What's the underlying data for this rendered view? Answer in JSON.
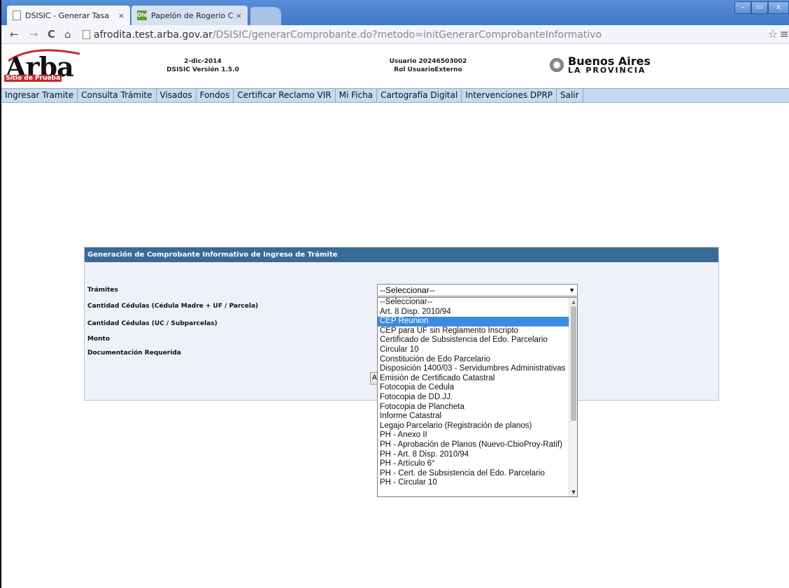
{
  "browser": {
    "tabs": [
      {
        "title": "DSISIC - Generar Tasa",
        "close": "×"
      },
      {
        "title": "Papelón de Rogerio Ceni | Ol",
        "close": "×",
        "favicon": "Olé"
      }
    ],
    "window_controls": {
      "minimize": "–",
      "maximize": "▭",
      "close": "x"
    },
    "nav": {
      "back": "←",
      "forward": "→",
      "reload": "C",
      "home": "⌂",
      "star": "☆",
      "menu": "≡"
    },
    "url": {
      "host": "afrodita.test.arba.gov.ar",
      "path": "/DSISIC/generarComprobante.do?metodo=initGenerarComprobanteInformativo"
    }
  },
  "header": {
    "logo": "Arba",
    "logo_sub": "Sitio de Prueba",
    "date": "2-dic-2014",
    "version": "DSISIC Versión 1.5.0",
    "user": "Usuario 20246503002",
    "role": "Rol UsuarioExterno",
    "province_line1": "Buenos Aires",
    "province_line2": "LA PROVINCIA"
  },
  "menu": [
    "Ingresar Tramite",
    "Consulta Trámite",
    "Visados",
    "Fondos",
    "Certificar Reclamo VIR",
    "Mi Ficha",
    "Cartografía Digital",
    "Intervenciones DPRP",
    "Salir"
  ],
  "form": {
    "title": "Generación de Comprobante Informativo de Ingreso de Trámite",
    "labels": {
      "tramites": "Trámites",
      "cedulas_madre": "Cantidad Cédulas (Cédula Madre + UF / Parcela)",
      "cedulas_uc": "Cantidad Cédulas (UC / Subparcelas)",
      "monto": "Monto",
      "documentacion": "Documentación Requerida"
    },
    "button_partial": "A",
    "select_value": "--Seleccionar--",
    "selected_option": "CEP Reunion",
    "options": [
      "--Seleccionar--",
      "Art. 8 Disp. 2010/94",
      "CEP Reunion",
      "CEP para UF sin Reglamento Inscripto",
      "Certificado de Subsistencia del Edo. Parcelario",
      "Circular 10",
      "Constitución de Edo Parcelario",
      "Disposición 1400/03 - Servidumbres Administrativas",
      "Emisión de Certificado Catastral",
      "Fotocopia de Cedula",
      "Fotocopia de DD.JJ.",
      "Fotocopia de Plancheta",
      "Informe Catastral",
      "Legajo Parcelario (Registración de planos)",
      "PH - Anexo II",
      "PH - Aprobación de Planos (Nuevo-CbioProy-Ratif)",
      "PH - Art. 8 Disp. 2010/94",
      "PH - Artículo 6°",
      "PH - Cert. de Subsistencia del Edo. Parcelario",
      "PH - Circular 10"
    ]
  }
}
